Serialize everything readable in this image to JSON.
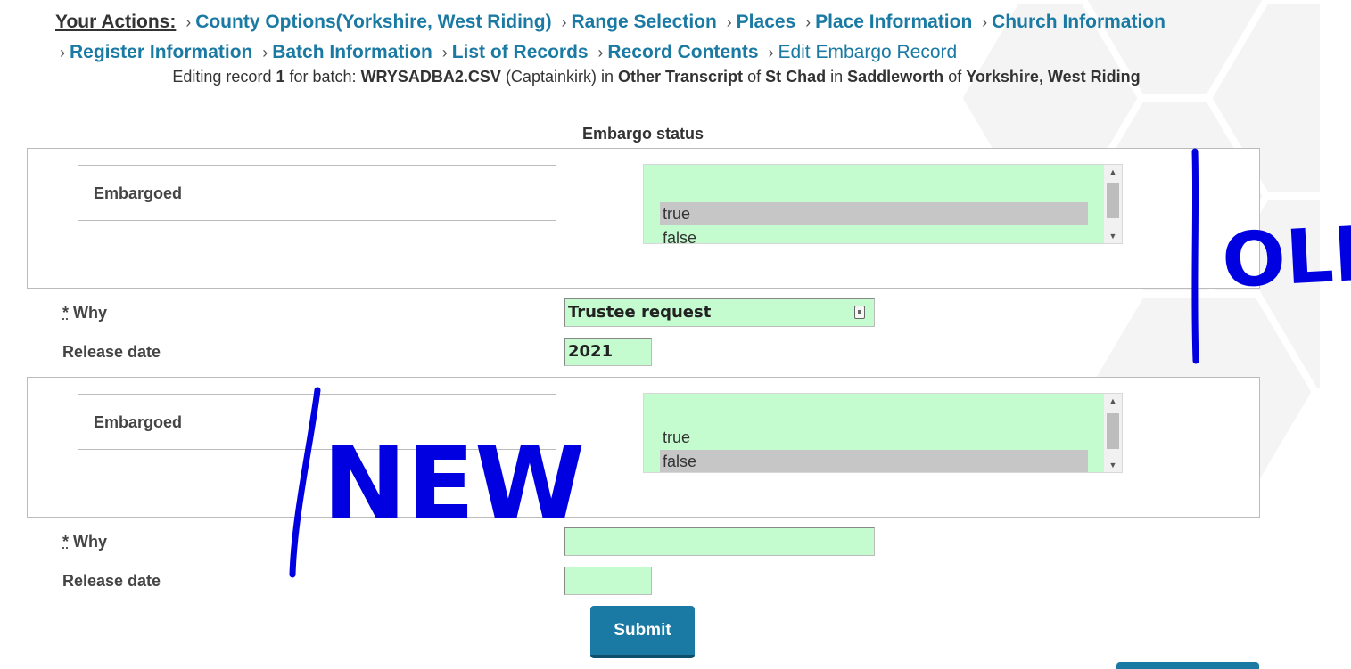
{
  "breadcrumb": {
    "lead": "Your Actions:",
    "items": [
      "County Options(Yorkshire, West Riding)",
      "Range Selection",
      "Places",
      "Place Information",
      "Church Information",
      "Register Information",
      "Batch Information",
      "List of Records",
      "Record Contents"
    ],
    "current": "Edit Embargo Record"
  },
  "edit_line": {
    "prefix": "Editing record",
    "record_number": "1",
    "for_batch": "for batch:",
    "batch": "WRYSADBA2.CSV",
    "user": "(Captainkirk)",
    "in1": "in",
    "transcript_type": "Other Transcript",
    "of1": "of",
    "church": "St Chad",
    "in2": "in",
    "place": "Saddleworth",
    "of2": "of",
    "county": "Yorkshire, West Riding"
  },
  "section_title": "Embargo status",
  "old": {
    "embargoed_label": "Embargoed",
    "options": [
      "true",
      "false"
    ],
    "selected": "true",
    "why_label": "Why",
    "why_value": "Trustee request",
    "release_label": "Release date",
    "release_value": "2021"
  },
  "new": {
    "embargoed_label": "Embargoed",
    "options": [
      "true",
      "false"
    ],
    "selected": "false",
    "why_label": "Why",
    "why_value": "",
    "release_label": "Release date",
    "release_value": ""
  },
  "required_marker": "*",
  "submit_label": "Submit",
  "annotations": {
    "old": "OLD",
    "new": "NEW",
    "color": "#0000e0"
  }
}
